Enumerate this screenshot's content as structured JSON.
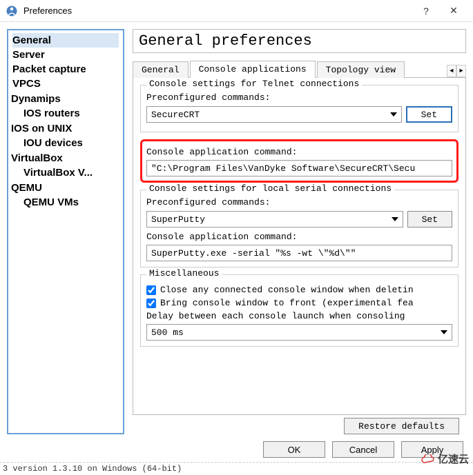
{
  "window": {
    "title": "Preferences"
  },
  "sidebar": {
    "items": [
      {
        "label": "General",
        "selected": true
      },
      {
        "label": "Server"
      },
      {
        "label": "Packet capture"
      },
      {
        "label": "VPCS"
      },
      {
        "label": "Dynamips",
        "expanded": true,
        "children": [
          {
            "label": "IOS routers"
          }
        ]
      },
      {
        "label": "IOS on UNIX",
        "expanded": true,
        "children": [
          {
            "label": "IOU devices"
          }
        ]
      },
      {
        "label": "VirtualBox",
        "expanded": true,
        "children": [
          {
            "label": "VirtualBox V..."
          }
        ]
      },
      {
        "label": "QEMU",
        "expanded": true,
        "children": [
          {
            "label": "QEMU VMs"
          }
        ]
      }
    ]
  },
  "main": {
    "heading": "General preferences",
    "tabs": [
      {
        "label": "General"
      },
      {
        "label": "Console applications",
        "active": true
      },
      {
        "label": "Topology view"
      }
    ],
    "telnet_group": {
      "legend": "Console settings for Telnet connections",
      "preconf_label": "Preconfigured commands:",
      "preconf_value": "SecureCRT",
      "set_label": "Set",
      "cmd_label": "Console application command:",
      "cmd_value": "\"C:\\Program Files\\VanDyke Software\\SecureCRT\\Secu"
    },
    "serial_group": {
      "legend": "Console settings for local serial connections",
      "preconf_label": "Preconfigured commands:",
      "preconf_value": "SuperPutty",
      "set_label": "Set",
      "cmd_label": "Console application command:",
      "cmd_value": "SuperPutty.exe -serial \"%s -wt \\\"%d\\\"\""
    },
    "misc_group": {
      "legend": "Miscellaneous",
      "close_label": "Close any connected console window when deletin",
      "close_checked": true,
      "front_label": "Bring console window to front (experimental fea",
      "front_checked": true,
      "delay_label": "Delay between each console launch when consoling",
      "delay_value": "500 ms"
    },
    "restore_label": "Restore defaults"
  },
  "footer": {
    "ok": "OK",
    "cancel": "Cancel",
    "apply": "Apply"
  },
  "statusbar": "3 version 1.3.10 on Windows (64-bit)",
  "watermark": "亿速云"
}
